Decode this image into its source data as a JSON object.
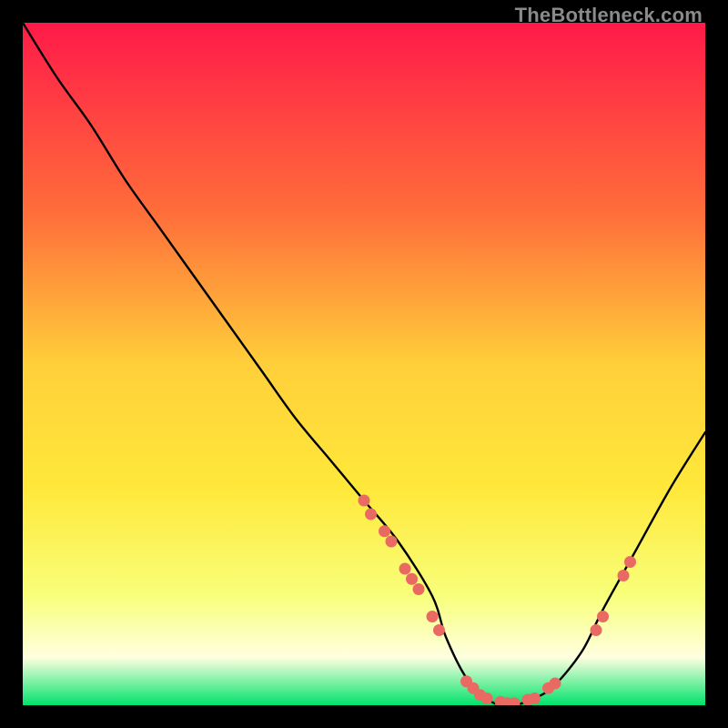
{
  "watermark": "TheBottleneck.com",
  "chart_data": {
    "type": "line",
    "title": "",
    "xlabel": "",
    "ylabel": "",
    "xlim": [
      0,
      100
    ],
    "ylim": [
      0,
      100
    ],
    "grid": false,
    "gradient": {
      "top": "#ff1a49",
      "mid_upper": "#ffa23a",
      "mid": "#ffe83a",
      "mid_lower": "#f8ff7a",
      "low": "#ffffe0",
      "bottom": "#00e36b"
    },
    "series": [
      {
        "name": "bottleneck-curve",
        "x": [
          0,
          5,
          10,
          15,
          20,
          25,
          30,
          35,
          40,
          45,
          50,
          55,
          60,
          62,
          65,
          68,
          70,
          72,
          75,
          78,
          82,
          85,
          90,
          95,
          100
        ],
        "y": [
          100,
          92,
          85,
          77,
          70,
          63,
          56,
          49,
          42,
          36,
          30,
          24,
          16,
          10,
          4,
          1,
          0,
          0,
          1,
          3,
          8,
          14,
          23,
          32,
          40
        ]
      }
    ],
    "markers": {
      "name": "highlight-points",
      "color": "#e96a63",
      "points": [
        {
          "x": 50,
          "y": 30
        },
        {
          "x": 51,
          "y": 28
        },
        {
          "x": 53,
          "y": 25.5
        },
        {
          "x": 54,
          "y": 24
        },
        {
          "x": 56,
          "y": 20
        },
        {
          "x": 57,
          "y": 18.5
        },
        {
          "x": 58,
          "y": 17
        },
        {
          "x": 60,
          "y": 13
        },
        {
          "x": 61,
          "y": 11
        },
        {
          "x": 65,
          "y": 3.5
        },
        {
          "x": 66,
          "y": 2.5
        },
        {
          "x": 67,
          "y": 1.5
        },
        {
          "x": 68,
          "y": 1
        },
        {
          "x": 70,
          "y": 0.5
        },
        {
          "x": 71,
          "y": 0.3
        },
        {
          "x": 72,
          "y": 0.3
        },
        {
          "x": 74,
          "y": 0.8
        },
        {
          "x": 75,
          "y": 1.0
        },
        {
          "x": 77,
          "y": 2.5
        },
        {
          "x": 78,
          "y": 3.2
        },
        {
          "x": 84,
          "y": 11
        },
        {
          "x": 85,
          "y": 13
        },
        {
          "x": 88,
          "y": 19
        },
        {
          "x": 89,
          "y": 21
        }
      ]
    }
  }
}
